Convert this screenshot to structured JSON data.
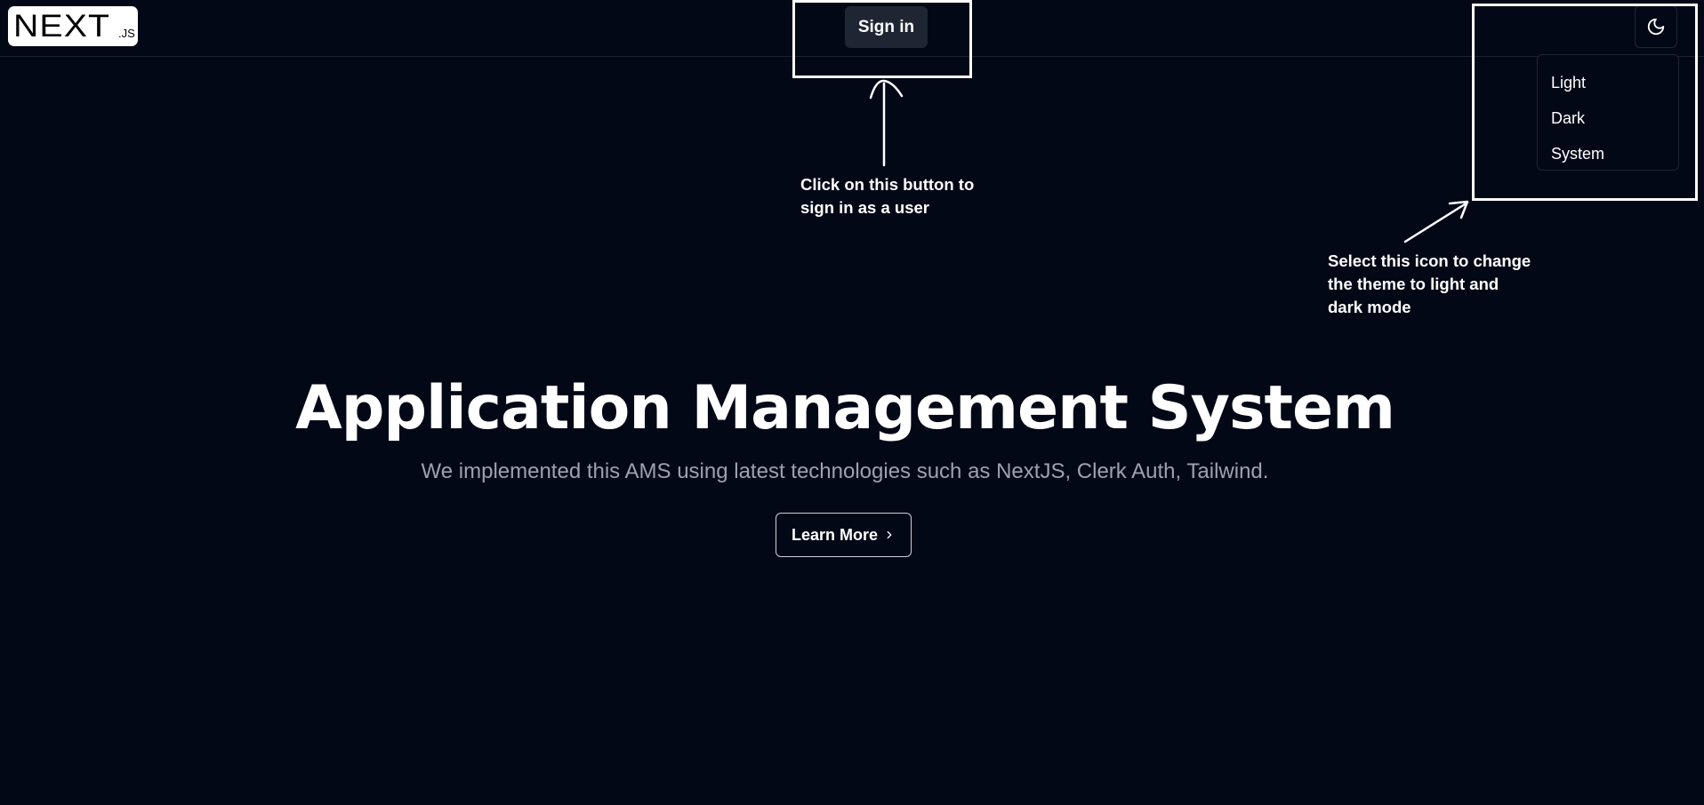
{
  "header": {
    "logo": {
      "main": "NEXT",
      "suffix": ".JS"
    },
    "signin_label": "Sign in",
    "theme_icon": "moon-icon"
  },
  "theme_menu": {
    "items": [
      {
        "label": "Light"
      },
      {
        "label": "Dark"
      },
      {
        "label": "System"
      }
    ]
  },
  "annotations": {
    "signin_note": {
      "line1": "Click on this button to",
      "line2": "sign in as a user"
    },
    "theme_note": {
      "line1": "Select this icon to change",
      "line2": "the theme to light and",
      "line3": "dark mode"
    }
  },
  "hero": {
    "title": "Application Management System",
    "subtitle": "We implemented this AMS using latest technologies such as NextJS, Clerk Auth, Tailwind.",
    "cta_label": "Learn More",
    "cta_icon": "chevron-right-icon"
  },
  "colors": {
    "background": "#030817",
    "button_bg": "#1e2533",
    "border": "#1e2636",
    "muted_text": "#9aa3b2",
    "annotation": "#ffffff"
  }
}
